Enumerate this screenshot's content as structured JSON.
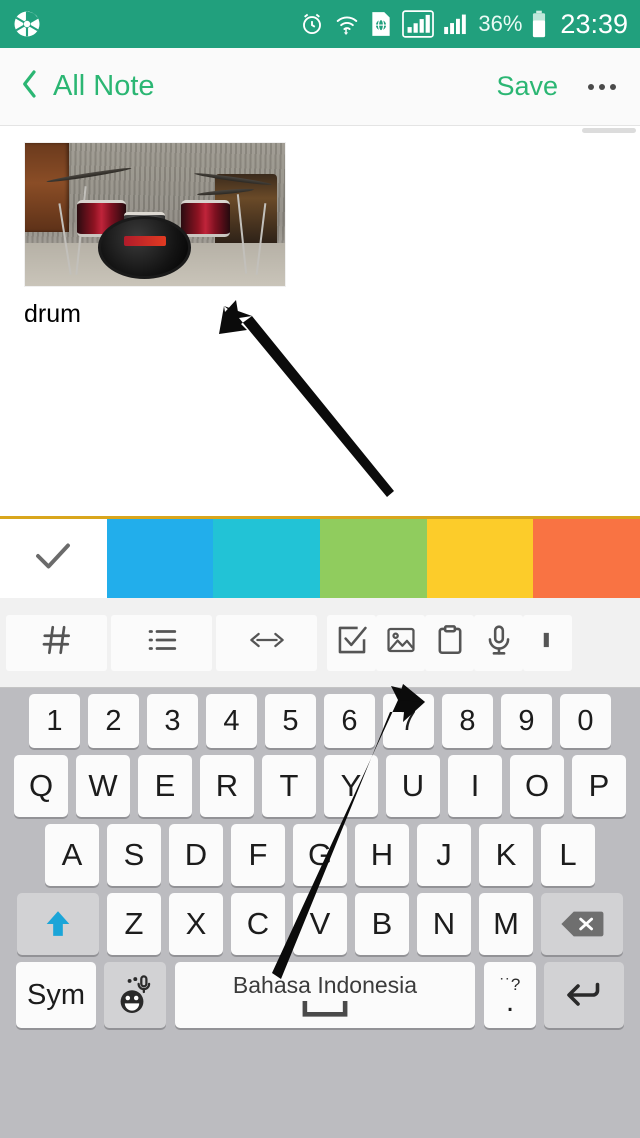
{
  "status_bar": {
    "background": "#21a07d",
    "left_icons": [
      "camera-aperture-icon"
    ],
    "right_icons": [
      "alarm-clock-icon",
      "wifi-icon",
      "globe-sim-icon",
      "signal-bars-boxed-icon",
      "signal-bars-icon"
    ],
    "battery_percent": "36%",
    "clock": "23:39"
  },
  "nav_bar": {
    "back_label": "All Note",
    "save_label": "Save",
    "overflow_label": "more-options",
    "accent_color": "#2bb673"
  },
  "note": {
    "attachment": {
      "caption": "drum",
      "alt": "drum-kit-photo"
    }
  },
  "palette": {
    "top_border_color": "#d9a61c",
    "swatches": [
      {
        "name": "white",
        "color": "#ffffff",
        "selected": true
      },
      {
        "name": "blue",
        "color": "#22aeeb",
        "selected": false
      },
      {
        "name": "cyan",
        "color": "#22c3d6",
        "selected": false
      },
      {
        "name": "green",
        "color": "#90cc5e",
        "selected": false
      },
      {
        "name": "yellow",
        "color": "#fccc2a",
        "selected": false
      },
      {
        "name": "orange",
        "color": "#f97343",
        "selected": false
      }
    ]
  },
  "format_toolbar": {
    "buttons": [
      {
        "name": "hashtag-icon",
        "label": "#"
      },
      {
        "name": "bullet-list-icon",
        "label": "list"
      },
      {
        "name": "code-brackets-icon",
        "label": "<>"
      },
      {
        "name": "checkbox-icon",
        "label": "checklist"
      },
      {
        "name": "image-icon",
        "label": "image"
      },
      {
        "name": "clipboard-icon",
        "label": "clipboard"
      },
      {
        "name": "microphone-icon",
        "label": "voice"
      },
      {
        "name": "pen-icon",
        "label": "draw"
      }
    ]
  },
  "keyboard": {
    "language": "Bahasa Indonesia",
    "rows": {
      "numbers": [
        "1",
        "2",
        "3",
        "4",
        "5",
        "6",
        "7",
        "8",
        "9",
        "0"
      ],
      "row1": [
        "Q",
        "W",
        "E",
        "R",
        "T",
        "Y",
        "U",
        "I",
        "O",
        "P"
      ],
      "row2": [
        "A",
        "S",
        "D",
        "F",
        "G",
        "H",
        "J",
        "K",
        "L"
      ],
      "row3": [
        "Z",
        "X",
        "C",
        "V",
        "B",
        "N",
        "M"
      ]
    },
    "shift_label": "shift",
    "backspace_label": "backspace",
    "sym_label": "Sym",
    "emoji_label": "emoji-mic",
    "period_top": "˙˙?",
    "period_main": ".",
    "enter_label": "enter"
  },
  "annotations": [
    {
      "name": "arrow-to-image-thumbnail",
      "points_to": "drum-thumbnail"
    },
    {
      "name": "arrow-to-image-toolbar-button",
      "points_to": "image-icon"
    }
  ]
}
